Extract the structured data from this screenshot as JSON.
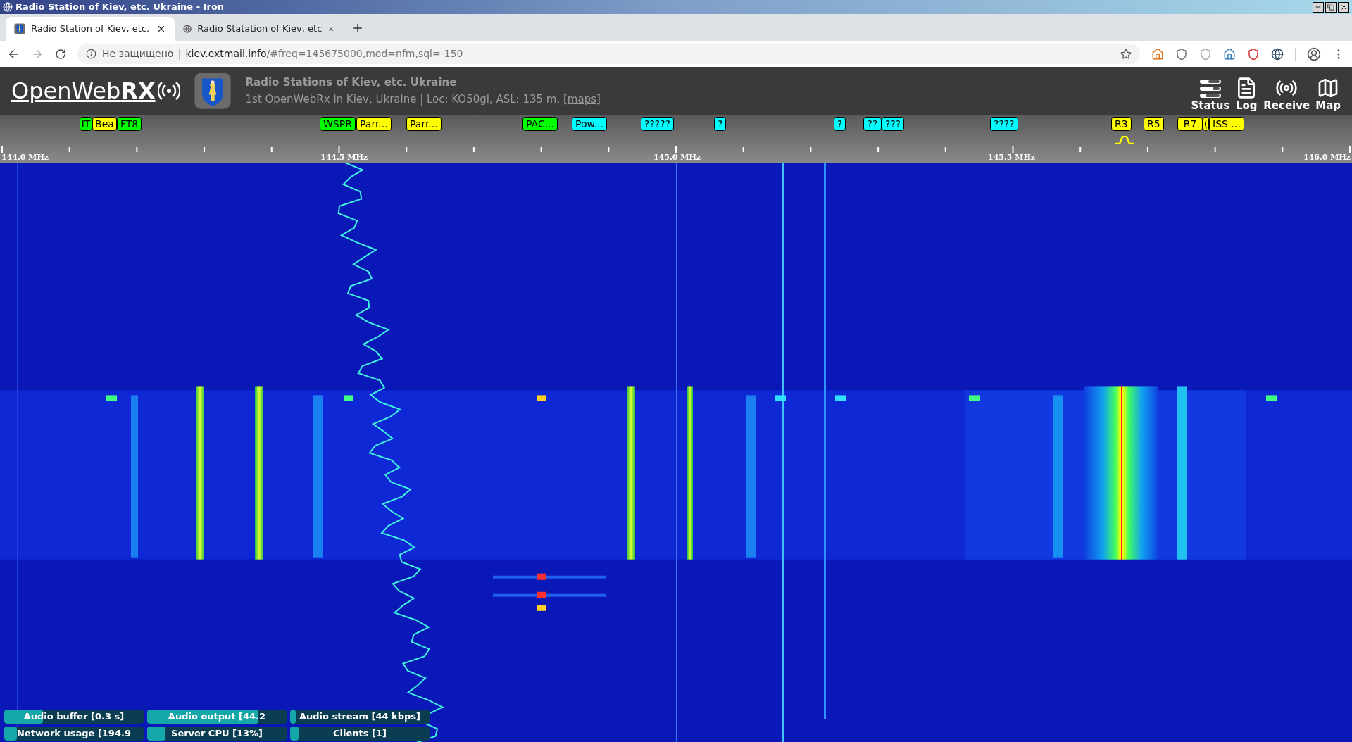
{
  "window": {
    "title": "Radio Station of Kiev, etc. Ukraine - Iron"
  },
  "tabs": [
    {
      "label": "Radio Station of Kiev, etc.",
      "selected": true
    },
    {
      "label": "Radio Statation of Kiev, etc",
      "selected": false
    }
  ],
  "address_bar": {
    "security": "Не защищено",
    "host": "kiev.extmail.info",
    "path": "/#freq=145675000,mod=nfm,sql=-150"
  },
  "header": {
    "logo": "OpenWeb**RX**",
    "title": "Radio Stations of Kiev, etc. Ukraine",
    "subtitle": "1st OpenWebRx in Kiev, Ukraine | Loc: KO50gl, ASL: 135 m, ",
    "maps_link": "[maps]",
    "buttons": [
      {
        "label": "Status",
        "kind": "status"
      },
      {
        "label": "Log",
        "kind": "log"
      },
      {
        "label": "Receive",
        "kind": "receive"
      },
      {
        "label": "Map",
        "kind": "map"
      }
    ]
  },
  "bookmarks": [
    {
      "label": "IT",
      "color": "#00ff00"
    },
    {
      "label": "Bea",
      "color": "#ffff00"
    },
    {
      "label": "FT8",
      "color": "#00ff00"
    },
    {
      "label": "WSPR",
      "color": "#00ff00"
    },
    {
      "label": "Parr...",
      "color": "#ffff00"
    },
    {
      "label": "Parr...",
      "color": "#ffff00"
    },
    {
      "label": "PAC...",
      "color": "#00ff00"
    },
    {
      "label": "Pow...",
      "color": "#00ffff"
    },
    {
      "label": "?????",
      "color": "#00ffff"
    },
    {
      "label": "?",
      "color": "#00ffff"
    },
    {
      "label": "?",
      "color": "#00ffff"
    },
    {
      "label": "??",
      "color": "#00ffff"
    },
    {
      "label": "???",
      "color": "#00ffff"
    },
    {
      "label": "????",
      "color": "#00ffff"
    },
    {
      "label": "R3",
      "color": "#ffff00"
    },
    {
      "label": "R5",
      "color": "#ffff00"
    },
    {
      "label": "R7",
      "color": "#ffff00"
    },
    {
      "label": "(",
      "color": "#ffff00"
    },
    {
      "label": "ISS ...",
      "color": "#ffff00"
    }
  ],
  "scale": {
    "labels": [
      "144.0 MHz",
      "144.5 MHz",
      "145.0 MHz",
      "145.5 MHz",
      "146.0 MHz"
    ]
  },
  "status_bars": [
    {
      "label": "Audio buffer [0.3 s]",
      "level": 0.28
    },
    {
      "label": "Audio output [44.2",
      "level": 0.8
    },
    {
      "label": "Audio stream [44 kbps]",
      "level": 0.04
    },
    {
      "label": "Network usage [194.9",
      "level": 0.09
    },
    {
      "label": "Server CPU [13%]",
      "level": 0.13
    },
    {
      "label": "Clients [1]",
      "level": 0.06
    }
  ]
}
